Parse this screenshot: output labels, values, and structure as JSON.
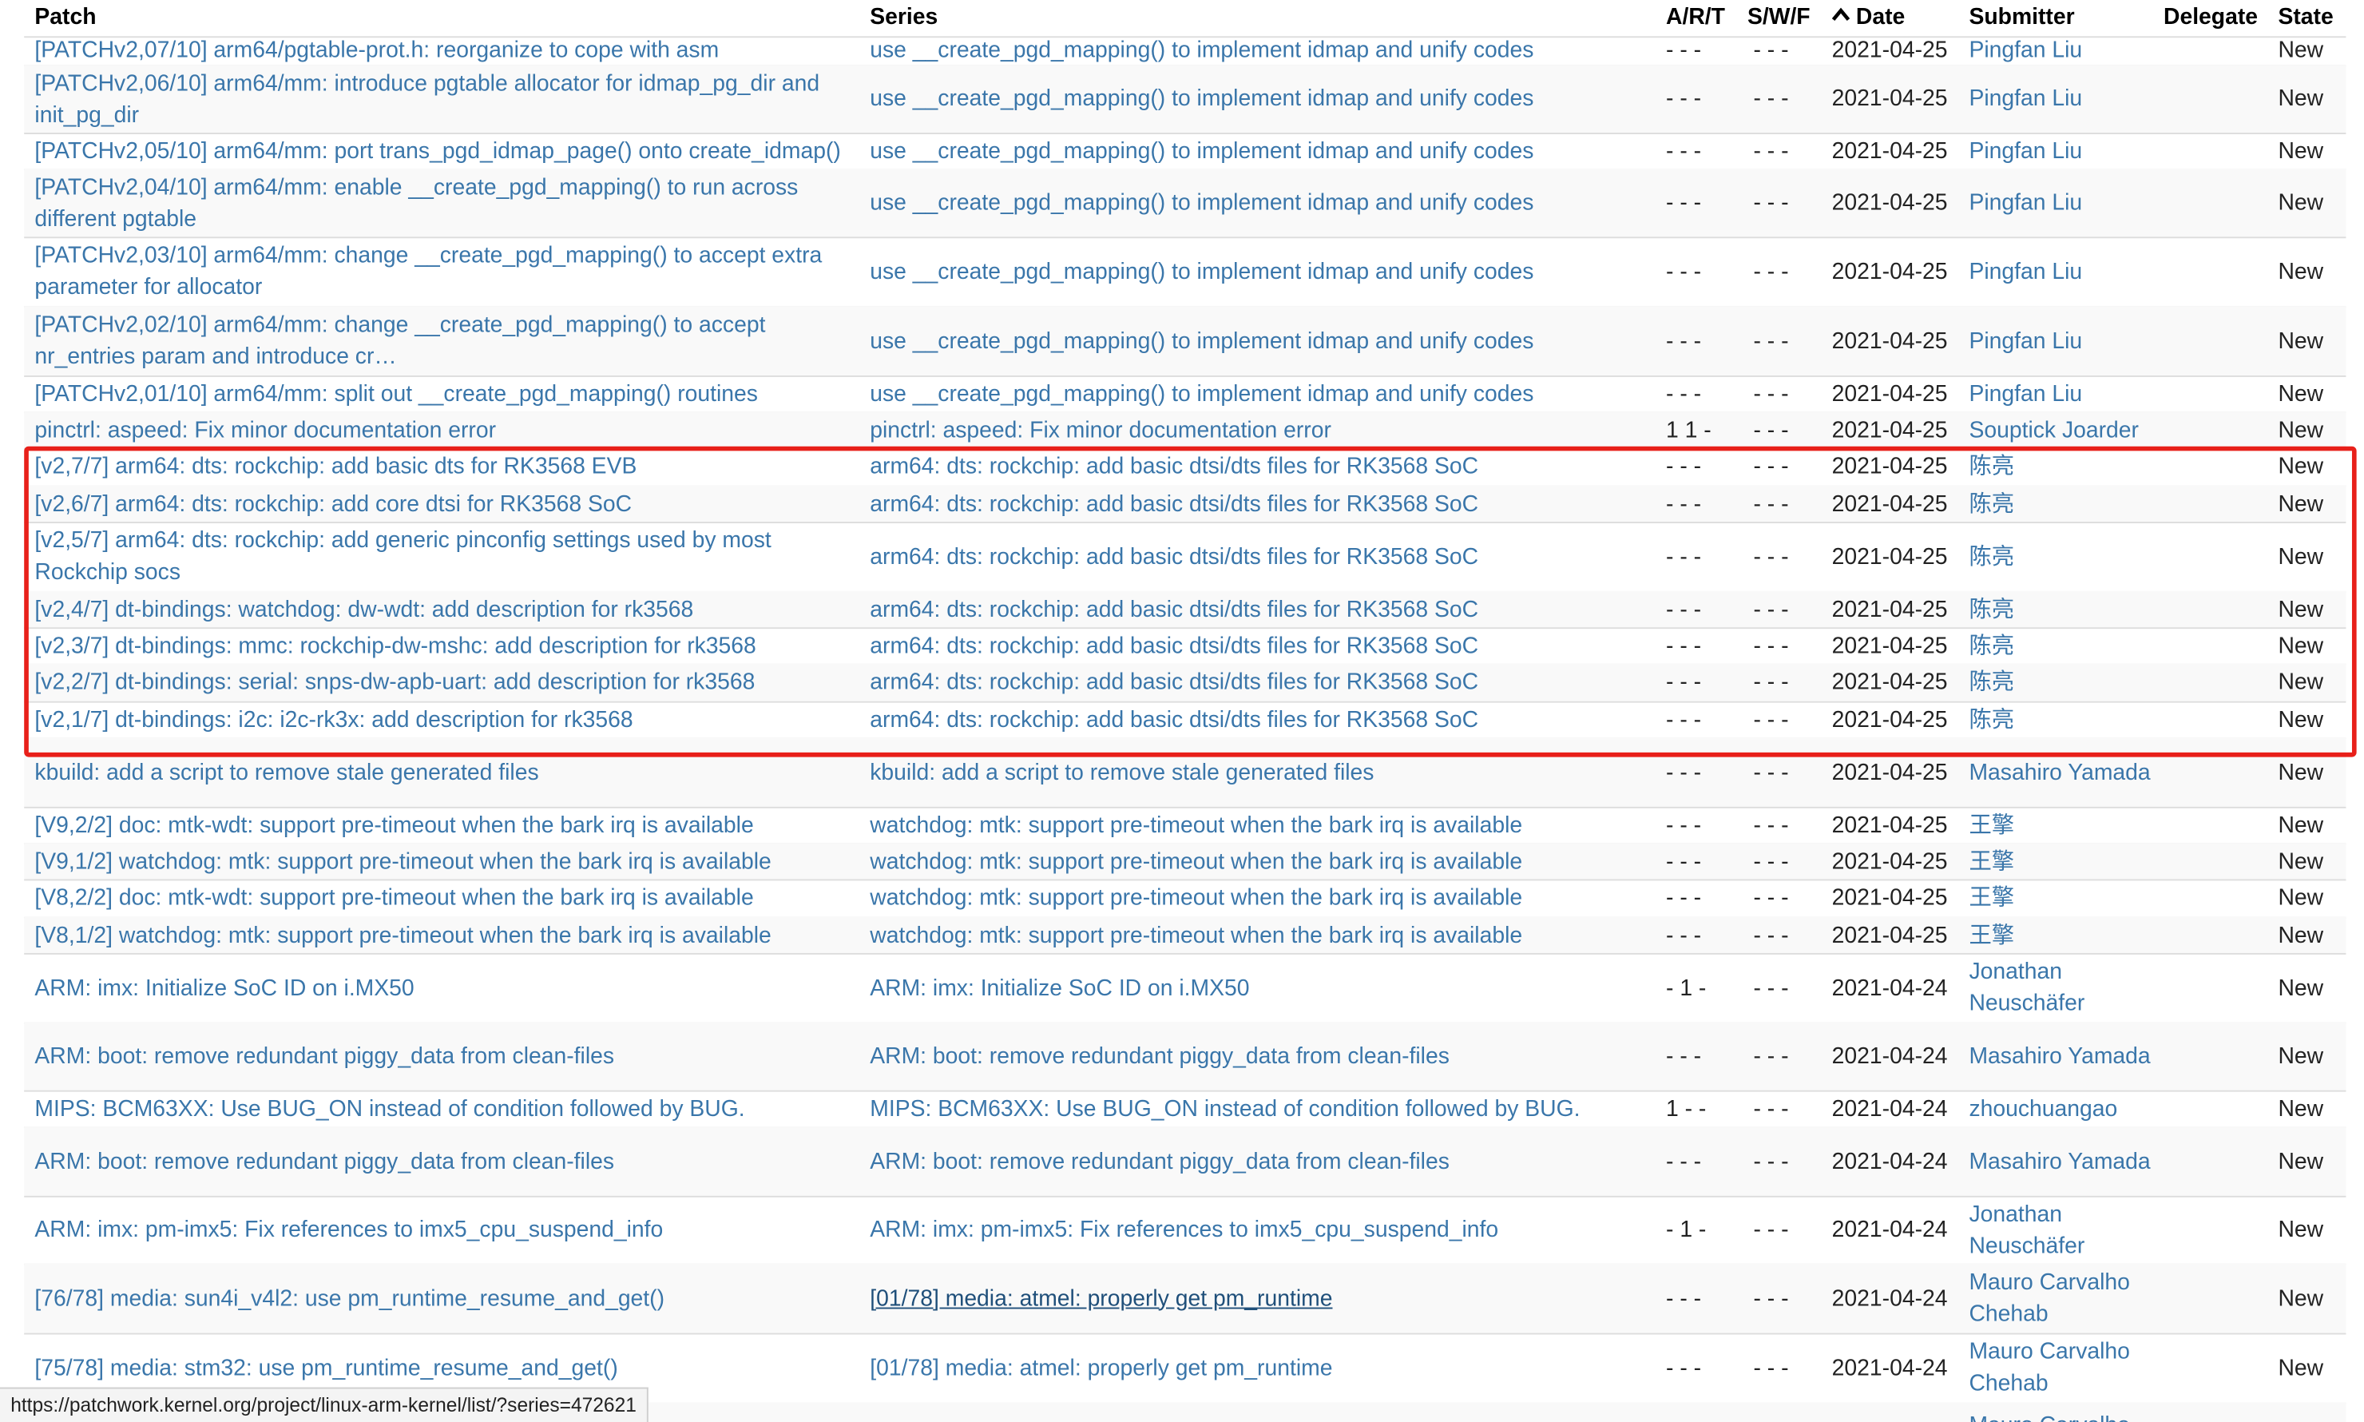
{
  "header": {
    "patch": "Patch",
    "series": "Series",
    "art": "A/R/T",
    "swf": "S/W/F",
    "date": "Date",
    "submitter": "Submitter",
    "delegate": "Delegate",
    "state": "State"
  },
  "rows": [
    {
      "patch": "[PATCHv2,07/10] arm64/pgtable-prot.h: reorganize to cope with asm",
      "series": "use __create_pgd_mapping() to implement idmap and unify codes",
      "art": "- - -",
      "swf": "- - -",
      "date": "2021-04-25",
      "submitter": "Pingfan Liu",
      "state": "New"
    },
    {
      "patch": "[PATCHv2,06/10] arm64/mm: introduce pgtable allocator for idmap_pg_dir and init_pg_dir",
      "series": "use __create_pgd_mapping() to implement idmap and unify codes",
      "art": "- - -",
      "swf": "- - -",
      "date": "2021-04-25",
      "submitter": "Pingfan Liu",
      "state": "New"
    },
    {
      "patch": "[PATCHv2,05/10] arm64/mm: port trans_pgd_idmap_page() onto create_idmap()",
      "series": "use __create_pgd_mapping() to implement idmap and unify codes",
      "art": "- - -",
      "swf": "- - -",
      "date": "2021-04-25",
      "submitter": "Pingfan Liu",
      "state": "New"
    },
    {
      "patch": "[PATCHv2,04/10] arm64/mm: enable __create_pgd_mapping() to run across different pgtable",
      "series": "use __create_pgd_mapping() to implement idmap and unify codes",
      "art": "- - -",
      "swf": "- - -",
      "date": "2021-04-25",
      "submitter": "Pingfan Liu",
      "state": "New"
    },
    {
      "patch": "[PATCHv2,03/10] arm64/mm: change __create_pgd_mapping() to accept extra parameter for allocator",
      "series": "use __create_pgd_mapping() to implement idmap and unify codes",
      "art": "- - -",
      "swf": "- - -",
      "date": "2021-04-25",
      "submitter": "Pingfan Liu",
      "state": "New"
    },
    {
      "patch": "[PATCHv2,02/10] arm64/mm: change __create_pgd_mapping() to accept nr_entries param and introduce cr…",
      "series": "use __create_pgd_mapping() to implement idmap and unify codes",
      "art": "- - -",
      "swf": "- - -",
      "date": "2021-04-25",
      "submitter": "Pingfan Liu",
      "state": "New"
    },
    {
      "patch": "[PATCHv2,01/10] arm64/mm: split out __create_pgd_mapping() routines",
      "series": "use __create_pgd_mapping() to implement idmap and unify codes",
      "art": "- - -",
      "swf": "- - -",
      "date": "2021-04-25",
      "submitter": "Pingfan Liu",
      "state": "New"
    },
    {
      "patch": "pinctrl: aspeed: Fix minor documentation error",
      "series": "pinctrl: aspeed: Fix minor documentation error",
      "art": "1 1 -",
      "swf": "- - -",
      "date": "2021-04-25",
      "submitter": "Souptick Joarder",
      "state": "New"
    },
    {
      "patch": "[v2,7/7] arm64: dts: rockchip: add basic dts for RK3568 EVB",
      "series": "arm64: dts: rockchip: add basic dtsi/dts files for RK3568 SoC",
      "art": "- - -",
      "swf": "- - -",
      "date": "2021-04-25",
      "submitter": "陈亮",
      "state": "New"
    },
    {
      "patch": "[v2,6/7] arm64: dts: rockchip: add core dtsi for RK3568 SoC",
      "series": "arm64: dts: rockchip: add basic dtsi/dts files for RK3568 SoC",
      "art": "- - -",
      "swf": "- - -",
      "date": "2021-04-25",
      "submitter": "陈亮",
      "state": "New"
    },
    {
      "patch": "[v2,5/7] arm64: dts: rockchip: add generic pinconfig settings used by most Rockchip socs",
      "series": "arm64: dts: rockchip: add basic dtsi/dts files for RK3568 SoC",
      "art": "- - -",
      "swf": "- - -",
      "date": "2021-04-25",
      "submitter": "陈亮",
      "state": "New"
    },
    {
      "patch": "[v2,4/7] dt-bindings: watchdog: dw-wdt: add description for rk3568",
      "series": "arm64: dts: rockchip: add basic dtsi/dts files for RK3568 SoC",
      "art": "- - -",
      "swf": "- - -",
      "date": "2021-04-25",
      "submitter": "陈亮",
      "state": "New"
    },
    {
      "patch": "[v2,3/7] dt-bindings: mmc: rockchip-dw-mshc: add description for rk3568",
      "series": "arm64: dts: rockchip: add basic dtsi/dts files for RK3568 SoC",
      "art": "- - -",
      "swf": "- - -",
      "date": "2021-04-25",
      "submitter": "陈亮",
      "state": "New"
    },
    {
      "patch": "[v2,2/7] dt-bindings: serial: snps-dw-apb-uart: add description for rk3568",
      "series": "arm64: dts: rockchip: add basic dtsi/dts files for RK3568 SoC",
      "art": "- - -",
      "swf": "- - -",
      "date": "2021-04-25",
      "submitter": "陈亮",
      "state": "New"
    },
    {
      "patch": "[v2,1/7] dt-bindings: i2c: i2c-rk3x: add description for rk3568",
      "series": "arm64: dts: rockchip: add basic dtsi/dts files for RK3568 SoC",
      "art": "- - -",
      "swf": "- - -",
      "date": "2021-04-25",
      "submitter": "陈亮",
      "state": "New"
    },
    {
      "patch": "kbuild: add a script to remove stale generated files",
      "series": "kbuild: add a script to remove stale generated files",
      "art": "- - -",
      "swf": "- - -",
      "date": "2021-04-25",
      "submitter": "Masahiro Yamada",
      "state": "New"
    },
    {
      "patch": "[V9,2/2] doc: mtk-wdt: support pre-timeout when the bark irq is available",
      "series": "watchdog: mtk: support pre-timeout when the bark irq is available",
      "art": "- - -",
      "swf": "- - -",
      "date": "2021-04-25",
      "submitter": "王擎",
      "state": "New"
    },
    {
      "patch": "[V9,1/2] watchdog: mtk: support pre-timeout when the bark irq is available",
      "series": "watchdog: mtk: support pre-timeout when the bark irq is available",
      "art": "- - -",
      "swf": "- - -",
      "date": "2021-04-25",
      "submitter": "王擎",
      "state": "New"
    },
    {
      "patch": "[V8,2/2] doc: mtk-wdt: support pre-timeout when the bark irq is available",
      "series": "watchdog: mtk: support pre-timeout when the bark irq is available",
      "art": "- - -",
      "swf": "- - -",
      "date": "2021-04-25",
      "submitter": "王擎",
      "state": "New"
    },
    {
      "patch": "[V8,1/2] watchdog: mtk: support pre-timeout when the bark irq is available",
      "series": "watchdog: mtk: support pre-timeout when the bark irq is available",
      "art": "- - -",
      "swf": "- - -",
      "date": "2021-04-25",
      "submitter": "王擎",
      "state": "New"
    },
    {
      "patch": "ARM: imx: Initialize SoC ID on i.MX50",
      "series": "ARM: imx: Initialize SoC ID on i.MX50",
      "art": "- 1 -",
      "swf": "- - -",
      "date": "2021-04-24",
      "submitter": "Jonathan Neuschäfer",
      "state": "New"
    },
    {
      "patch": "ARM: boot: remove redundant piggy_data from clean-files",
      "series": "ARM: boot: remove redundant piggy_data from clean-files",
      "art": "- - -",
      "swf": "- - -",
      "date": "2021-04-24",
      "submitter": "Masahiro Yamada",
      "state": "New"
    },
    {
      "patch": "MIPS: BCM63XX: Use BUG_ON instead of condition followed by BUG.",
      "series": "MIPS: BCM63XX: Use BUG_ON instead of condition followed by BUG.",
      "art": "1 - -",
      "swf": "- - -",
      "date": "2021-04-24",
      "submitter": "zhouchuangao",
      "state": "New"
    },
    {
      "patch": "ARM: boot: remove redundant piggy_data from clean-files",
      "series": "ARM: boot: remove redundant piggy_data from clean-files",
      "art": "- - -",
      "swf": "- - -",
      "date": "2021-04-24",
      "submitter": "Masahiro Yamada",
      "state": "New"
    },
    {
      "patch": "ARM: imx: pm-imx5: Fix references to imx5_cpu_suspend_info",
      "series": "ARM: imx: pm-imx5: Fix references to imx5_cpu_suspend_info",
      "art": "- 1 -",
      "swf": "- - -",
      "date": "2021-04-24",
      "submitter": "Jonathan Neuschäfer",
      "state": "New"
    },
    {
      "patch": "[76/78] media: sun4i_v4l2: use pm_runtime_resume_and_get()",
      "series": "[01/78] media: atmel: properly get pm_runtime",
      "art": "- - -",
      "swf": "- - -",
      "date": "2021-04-24",
      "submitter": "Mauro Carvalho Chehab",
      "state": "New",
      "series_hover": true
    },
    {
      "patch": "[75/78] media: stm32: use pm_runtime_resume_and_get()",
      "series": "[01/78] media: atmel: properly get pm_runtime",
      "art": "- - -",
      "swf": "- - -",
      "date": "2021-04-24",
      "submitter": "Mauro Carvalho Chehab",
      "state": "New"
    },
    {
      "patch": "",
      "series": "",
      "art": "",
      "swf": "",
      "date": "",
      "submitter": "Mauro Carvalho",
      "state": ""
    }
  ],
  "status_bar": {
    "url": "https://patchwork.kernel.org/project/linux-arm-kernel/list/?series=472621"
  },
  "colors": {
    "link": "#3a76aa",
    "highlight_border": "#e8201a"
  }
}
